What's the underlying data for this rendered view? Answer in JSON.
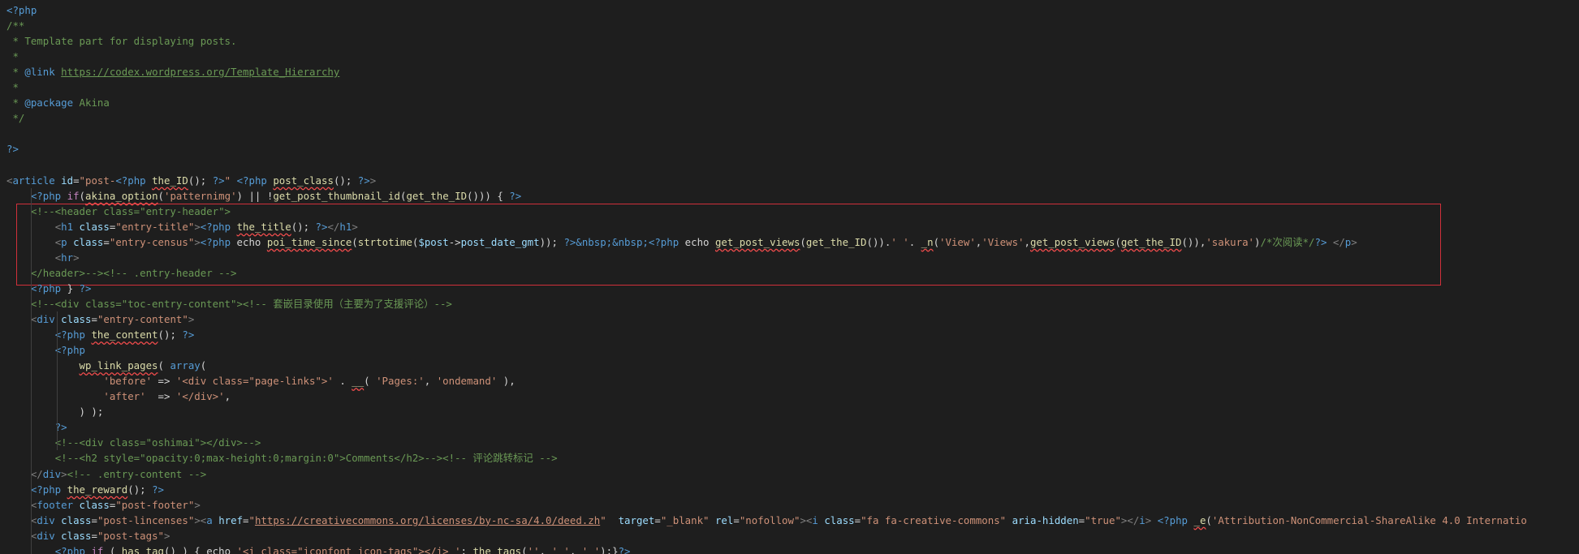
{
  "editor": {
    "theme_colors": {
      "background": "#1e1e1e",
      "keyword": "#569cd6",
      "attribute": "#9cdcfe",
      "string": "#ce9178",
      "function": "#dcdcaa",
      "comment": "#6a9955",
      "highlight_box": "#d0303a"
    },
    "lines": [
      [
        {
          "t": "<?php",
          "c": "php"
        }
      ],
      [
        {
          "t": "/**",
          "c": "cmt"
        }
      ],
      [
        {
          "t": " * Template part for displaying posts.",
          "c": "cmt"
        }
      ],
      [
        {
          "t": " *",
          "c": "cmt"
        }
      ],
      [
        {
          "t": " * ",
          "c": "cmt"
        },
        {
          "t": "@link",
          "c": "kw"
        },
        {
          "t": " ",
          "c": "cmt"
        },
        {
          "t": "https://codex.wordpress.org/Template_Hierarchy",
          "c": "link"
        }
      ],
      [
        {
          "t": " *",
          "c": "cmt"
        }
      ],
      [
        {
          "t": " * ",
          "c": "cmt"
        },
        {
          "t": "@package",
          "c": "kw"
        },
        {
          "t": " Akina",
          "c": "cmt"
        }
      ],
      [
        {
          "t": " */",
          "c": "cmt"
        }
      ],
      [],
      [
        {
          "t": "?>",
          "c": "php"
        }
      ],
      [],
      [
        {
          "t": "<",
          "c": "gray"
        },
        {
          "t": "article",
          "c": "tag"
        },
        {
          "t": " ",
          "c": "plain"
        },
        {
          "t": "id",
          "c": "attr"
        },
        {
          "t": "=",
          "c": "plain"
        },
        {
          "t": "\"post-",
          "c": "str"
        },
        {
          "t": "<?php",
          "c": "php"
        },
        {
          "t": " ",
          "c": "plain"
        },
        {
          "t": "the_ID",
          "c": "fn",
          "e": true
        },
        {
          "t": "(); ",
          "c": "plain"
        },
        {
          "t": "?>",
          "c": "php"
        },
        {
          "t": "\"",
          "c": "str"
        },
        {
          "t": " ",
          "c": "plain"
        },
        {
          "t": "<?php",
          "c": "php"
        },
        {
          "t": " ",
          "c": "plain"
        },
        {
          "t": "post_class",
          "c": "fn",
          "e": true
        },
        {
          "t": "(); ",
          "c": "plain"
        },
        {
          "t": "?>",
          "c": "php"
        },
        {
          "t": ">",
          "c": "gray"
        }
      ],
      [
        {
          "t": "    ",
          "c": "plain"
        },
        {
          "t": "<?php",
          "c": "php"
        },
        {
          "t": " ",
          "c": "plain"
        },
        {
          "t": "if",
          "c": "ctrl"
        },
        {
          "t": "(",
          "c": "plain"
        },
        {
          "t": "akina_option",
          "c": "fn",
          "e": true
        },
        {
          "t": "(",
          "c": "plain"
        },
        {
          "t": "'patternimg'",
          "c": "str"
        },
        {
          "t": ") || !",
          "c": "plain"
        },
        {
          "t": "get_post_thumbnail_id",
          "c": "fn"
        },
        {
          "t": "(",
          "c": "plain"
        },
        {
          "t": "get_the_ID",
          "c": "fn"
        },
        {
          "t": "())) { ",
          "c": "plain"
        },
        {
          "t": "?>",
          "c": "php"
        }
      ],
      [
        {
          "t": "    ",
          "c": "plain"
        },
        {
          "t": "<!--<header class=\"entry-header\">",
          "c": "cmt"
        }
      ],
      [
        {
          "t": "        ",
          "c": "plain"
        },
        {
          "t": "<",
          "c": "gray"
        },
        {
          "t": "h1",
          "c": "tag"
        },
        {
          "t": " ",
          "c": "plain"
        },
        {
          "t": "class",
          "c": "attr"
        },
        {
          "t": "=",
          "c": "plain"
        },
        {
          "t": "\"entry-title\"",
          "c": "str"
        },
        {
          "t": ">",
          "c": "gray"
        },
        {
          "t": "<?php",
          "c": "php"
        },
        {
          "t": " ",
          "c": "plain"
        },
        {
          "t": "the_title",
          "c": "fn",
          "e": true
        },
        {
          "t": "(); ",
          "c": "plain"
        },
        {
          "t": "?>",
          "c": "php"
        },
        {
          "t": "</",
          "c": "gray"
        },
        {
          "t": "h1",
          "c": "tag"
        },
        {
          "t": ">",
          "c": "gray"
        }
      ],
      [
        {
          "t": "        ",
          "c": "plain"
        },
        {
          "t": "<",
          "c": "gray"
        },
        {
          "t": "p",
          "c": "tag"
        },
        {
          "t": " ",
          "c": "plain"
        },
        {
          "t": "class",
          "c": "attr"
        },
        {
          "t": "=",
          "c": "plain"
        },
        {
          "t": "\"entry-census\"",
          "c": "str"
        },
        {
          "t": ">",
          "c": "gray"
        },
        {
          "t": "<?php",
          "c": "php"
        },
        {
          "t": " echo ",
          "c": "plain"
        },
        {
          "t": "poi_time_since",
          "c": "fn",
          "e": true
        },
        {
          "t": "(",
          "c": "plain"
        },
        {
          "t": "strtotime",
          "c": "fn"
        },
        {
          "t": "(",
          "c": "plain"
        },
        {
          "t": "$post",
          "c": "var"
        },
        {
          "t": "->",
          "c": "plain"
        },
        {
          "t": "post_date_gmt",
          "c": "var"
        },
        {
          "t": ")); ",
          "c": "plain"
        },
        {
          "t": "?>",
          "c": "php"
        },
        {
          "t": "&nbsp;&nbsp;",
          "c": "ent"
        },
        {
          "t": "<?php",
          "c": "php"
        },
        {
          "t": " echo ",
          "c": "plain"
        },
        {
          "t": "get_post_views",
          "c": "fn",
          "e": true
        },
        {
          "t": "(",
          "c": "plain"
        },
        {
          "t": "get_the_ID",
          "c": "fn"
        },
        {
          "t": "()).",
          "c": "plain"
        },
        {
          "t": "' '",
          "c": "str"
        },
        {
          "t": ". ",
          "c": "plain"
        },
        {
          "t": "_n",
          "c": "fn",
          "e": true
        },
        {
          "t": "(",
          "c": "plain"
        },
        {
          "t": "'View'",
          "c": "str"
        },
        {
          "t": ",",
          "c": "plain"
        },
        {
          "t": "'Views'",
          "c": "str"
        },
        {
          "t": ",",
          "c": "plain"
        },
        {
          "t": "get_post_views",
          "c": "fn",
          "e": true
        },
        {
          "t": "(",
          "c": "plain"
        },
        {
          "t": "get_the_ID",
          "c": "fn",
          "e": true
        },
        {
          "t": "()),",
          "c": "plain"
        },
        {
          "t": "'sakura'",
          "c": "str"
        },
        {
          "t": ")",
          "c": "plain"
        },
        {
          "t": "/*次阅读*/",
          "c": "cmt"
        },
        {
          "t": "?>",
          "c": "php"
        },
        {
          "t": " ",
          "c": "plain"
        },
        {
          "t": "</",
          "c": "gray"
        },
        {
          "t": "p",
          "c": "tag"
        },
        {
          "t": ">",
          "c": "gray"
        }
      ],
      [
        {
          "t": "        ",
          "c": "plain"
        },
        {
          "t": "<",
          "c": "gray"
        },
        {
          "t": "hr",
          "c": "tag"
        },
        {
          "t": ">",
          "c": "gray"
        }
      ],
      [
        {
          "t": "    ",
          "c": "plain"
        },
        {
          "t": "</header>-->",
          "c": "cmt"
        },
        {
          "t": "<!-- .entry-header -->",
          "c": "cmt"
        }
      ],
      [
        {
          "t": "    ",
          "c": "plain"
        },
        {
          "t": "<?php",
          "c": "php"
        },
        {
          "t": " } ",
          "c": "plain"
        },
        {
          "t": "?>",
          "c": "php"
        }
      ],
      [
        {
          "t": "    ",
          "c": "plain"
        },
        {
          "t": "<!--<div class=\"toc-entry-content\">",
          "c": "cmt"
        },
        {
          "t": "<!-- 套嵌目录使用（主要为了支援评论）-->",
          "c": "cmt"
        }
      ],
      [
        {
          "t": "    ",
          "c": "plain"
        },
        {
          "t": "<",
          "c": "gray"
        },
        {
          "t": "div",
          "c": "tag"
        },
        {
          "t": " ",
          "c": "plain"
        },
        {
          "t": "class",
          "c": "attr"
        },
        {
          "t": "=",
          "c": "plain"
        },
        {
          "t": "\"entry-content\"",
          "c": "str"
        },
        {
          "t": ">",
          "c": "gray"
        }
      ],
      [
        {
          "t": "        ",
          "c": "plain"
        },
        {
          "t": "<?php",
          "c": "php"
        },
        {
          "t": " ",
          "c": "plain"
        },
        {
          "t": "the_content",
          "c": "fn",
          "e": true
        },
        {
          "t": "(); ",
          "c": "plain"
        },
        {
          "t": "?>",
          "c": "php"
        }
      ],
      [
        {
          "t": "        ",
          "c": "plain"
        },
        {
          "t": "<?php",
          "c": "php"
        }
      ],
      [
        {
          "t": "            ",
          "c": "plain"
        },
        {
          "t": "wp_link_pages",
          "c": "fn",
          "e": true
        },
        {
          "t": "( ",
          "c": "plain"
        },
        {
          "t": "array",
          "c": "kw"
        },
        {
          "t": "(",
          "c": "plain"
        }
      ],
      [
        {
          "t": "                ",
          "c": "plain"
        },
        {
          "t": "'before'",
          "c": "str"
        },
        {
          "t": " => ",
          "c": "plain"
        },
        {
          "t": "'<div class=\"page-links\">'",
          "c": "str"
        },
        {
          "t": " . ",
          "c": "plain"
        },
        {
          "t": "__",
          "c": "fn",
          "e": true
        },
        {
          "t": "( ",
          "c": "plain"
        },
        {
          "t": "'Pages:'",
          "c": "str"
        },
        {
          "t": ", ",
          "c": "plain"
        },
        {
          "t": "'ondemand'",
          "c": "str"
        },
        {
          "t": " ),",
          "c": "plain"
        }
      ],
      [
        {
          "t": "                ",
          "c": "plain"
        },
        {
          "t": "'after'",
          "c": "str"
        },
        {
          "t": "  => ",
          "c": "plain"
        },
        {
          "t": "'</div>'",
          "c": "str"
        },
        {
          "t": ",",
          "c": "plain"
        }
      ],
      [
        {
          "t": "            ) );",
          "c": "plain"
        }
      ],
      [
        {
          "t": "        ",
          "c": "plain"
        },
        {
          "t": "?>",
          "c": "php"
        }
      ],
      [
        {
          "t": "        ",
          "c": "plain"
        },
        {
          "t": "<!--<div class=\"oshimai\"></div>-->",
          "c": "cmt"
        }
      ],
      [
        {
          "t": "        ",
          "c": "plain"
        },
        {
          "t": "<!--<h2 style=\"opacity:0;max-height:0;margin:0\">Comments</h2>-->",
          "c": "cmt"
        },
        {
          "t": "<!-- 评论跳转标记 -->",
          "c": "cmt"
        }
      ],
      [
        {
          "t": "    ",
          "c": "plain"
        },
        {
          "t": "</",
          "c": "gray"
        },
        {
          "t": "div",
          "c": "tag"
        },
        {
          "t": ">",
          "c": "gray"
        },
        {
          "t": "<!-- .entry-content -->",
          "c": "cmt"
        }
      ],
      [
        {
          "t": "    ",
          "c": "plain"
        },
        {
          "t": "<?php",
          "c": "php"
        },
        {
          "t": " ",
          "c": "plain"
        },
        {
          "t": "the_reward",
          "c": "fn",
          "e": true
        },
        {
          "t": "(); ",
          "c": "plain"
        },
        {
          "t": "?>",
          "c": "php"
        }
      ],
      [
        {
          "t": "    ",
          "c": "plain"
        },
        {
          "t": "<",
          "c": "gray"
        },
        {
          "t": "footer",
          "c": "tag"
        },
        {
          "t": " ",
          "c": "plain"
        },
        {
          "t": "class",
          "c": "attr"
        },
        {
          "t": "=",
          "c": "plain"
        },
        {
          "t": "\"post-footer\"",
          "c": "str"
        },
        {
          "t": ">",
          "c": "gray"
        }
      ],
      [
        {
          "t": "    ",
          "c": "plain"
        },
        {
          "t": "<",
          "c": "gray"
        },
        {
          "t": "div",
          "c": "tag"
        },
        {
          "t": " ",
          "c": "plain"
        },
        {
          "t": "class",
          "c": "attr"
        },
        {
          "t": "=",
          "c": "plain"
        },
        {
          "t": "\"post-lincenses\"",
          "c": "str"
        },
        {
          "t": ">",
          "c": "gray"
        },
        {
          "t": "<",
          "c": "gray"
        },
        {
          "t": "a",
          "c": "tag"
        },
        {
          "t": " ",
          "c": "plain"
        },
        {
          "t": "href",
          "c": "attr"
        },
        {
          "t": "=",
          "c": "plain"
        },
        {
          "t": "\"",
          "c": "str"
        },
        {
          "t": "https://creativecommons.org/licenses/by-nc-sa/4.0/deed.zh",
          "c": "str",
          "u": true
        },
        {
          "t": "\"",
          "c": "str"
        },
        {
          "t": "  ",
          "c": "plain"
        },
        {
          "t": "target",
          "c": "attr"
        },
        {
          "t": "=",
          "c": "plain"
        },
        {
          "t": "\"_blank\"",
          "c": "str"
        },
        {
          "t": " ",
          "c": "plain"
        },
        {
          "t": "rel",
          "c": "attr"
        },
        {
          "t": "=",
          "c": "plain"
        },
        {
          "t": "\"nofollow\"",
          "c": "str"
        },
        {
          "t": ">",
          "c": "gray"
        },
        {
          "t": "<",
          "c": "gray"
        },
        {
          "t": "i",
          "c": "tag"
        },
        {
          "t": " ",
          "c": "plain"
        },
        {
          "t": "class",
          "c": "attr"
        },
        {
          "t": "=",
          "c": "plain"
        },
        {
          "t": "\"fa fa-creative-commons\"",
          "c": "str"
        },
        {
          "t": " ",
          "c": "plain"
        },
        {
          "t": "aria-hidden",
          "c": "attr"
        },
        {
          "t": "=",
          "c": "plain"
        },
        {
          "t": "\"true\"",
          "c": "str"
        },
        {
          "t": ">",
          "c": "gray"
        },
        {
          "t": "</",
          "c": "gray"
        },
        {
          "t": "i",
          "c": "tag"
        },
        {
          "t": ">",
          "c": "gray"
        },
        {
          "t": " ",
          "c": "plain"
        },
        {
          "t": "<?php",
          "c": "php"
        },
        {
          "t": " ",
          "c": "plain"
        },
        {
          "t": "_e",
          "c": "fn",
          "e": true
        },
        {
          "t": "(",
          "c": "plain"
        },
        {
          "t": "'Attribution-NonCommercial-ShareAlike 4.0 Internatio",
          "c": "str"
        }
      ],
      [
        {
          "t": "    ",
          "c": "plain"
        },
        {
          "t": "<",
          "c": "gray"
        },
        {
          "t": "div",
          "c": "tag"
        },
        {
          "t": " ",
          "c": "plain"
        },
        {
          "t": "class",
          "c": "attr"
        },
        {
          "t": "=",
          "c": "plain"
        },
        {
          "t": "\"post-tags\"",
          "c": "str"
        },
        {
          "t": ">",
          "c": "gray"
        }
      ],
      [
        {
          "t": "        ",
          "c": "plain"
        },
        {
          "t": "<?php",
          "c": "php"
        },
        {
          "t": " ",
          "c": "plain"
        },
        {
          "t": "if",
          "c": "ctrl"
        },
        {
          "t": " ( ",
          "c": "plain"
        },
        {
          "t": "has_tag",
          "c": "fn"
        },
        {
          "t": "() ) { ",
          "c": "plain"
        },
        {
          "t": "echo",
          "c": "plain"
        },
        {
          "t": " ",
          "c": "plain"
        },
        {
          "t": "'<i class=\"iconfont icon-tags\"></i> '",
          "c": "str"
        },
        {
          "t": "; ",
          "c": "plain"
        },
        {
          "t": "the_tags",
          "c": "fn"
        },
        {
          "t": "(",
          "c": "plain"
        },
        {
          "t": "''",
          "c": "str"
        },
        {
          "t": ", ",
          "c": "plain"
        },
        {
          "t": "' '",
          "c": "str"
        },
        {
          "t": ", ",
          "c": "plain"
        },
        {
          "t": "' '",
          "c": "str"
        },
        {
          "t": ");}",
          "c": "plain"
        },
        {
          "t": "?>",
          "c": "php"
        }
      ]
    ]
  }
}
